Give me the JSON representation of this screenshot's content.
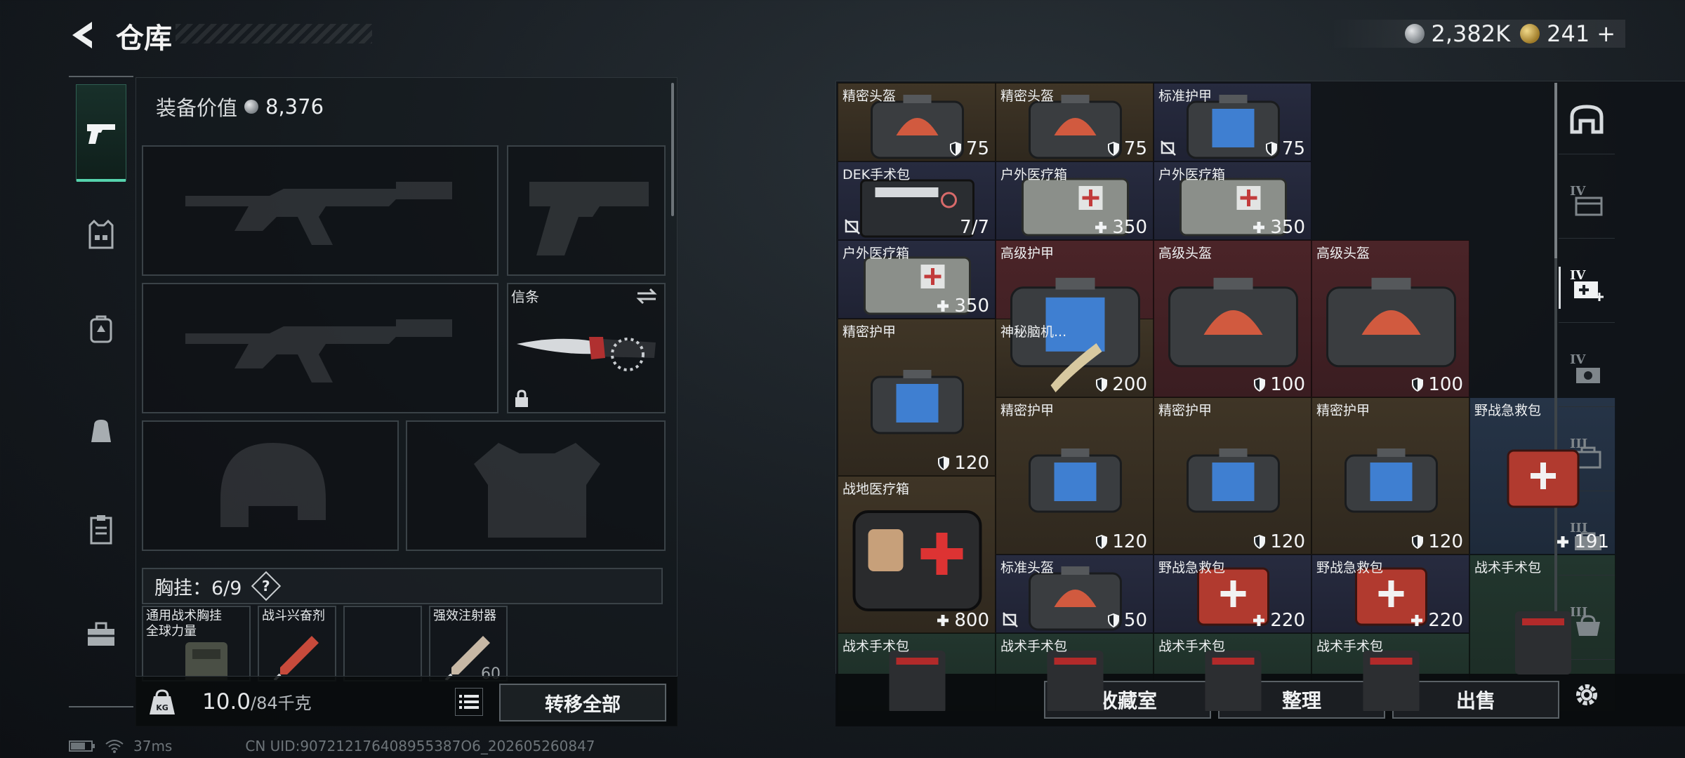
{
  "header": {
    "title": "仓库",
    "silver_amount": "2,382K",
    "gold_amount": "241",
    "gold_add": "+"
  },
  "equipment": {
    "value_label": "装备价值",
    "value": "8,376",
    "melee_label": "信条",
    "chest_label": "胸挂：",
    "chest_count": "6/9",
    "help": "?",
    "small_slots": [
      {
        "label": "通用战术胸挂\n全球力量",
        "amount": ""
      },
      {
        "label": "战斗兴奋剂",
        "amount": ""
      },
      {
        "label": "",
        "amount": ""
      },
      {
        "label": "强效注射器",
        "amount": "60"
      }
    ],
    "weight_value": "10.0",
    "weight_unit": "/84千克",
    "weight_icon_text": "KG",
    "transfer_all": "转移全部"
  },
  "status": {
    "ping": "37ms",
    "uid": "CN UID:907212176408955387O6_202605260847"
  },
  "storage": {
    "items": [
      {
        "name": "精密头盔",
        "value": "75",
        "kind": "shield",
        "bg": "brown",
        "art": "helmet"
      },
      {
        "name": "精密头盔",
        "value": "75",
        "kind": "shield",
        "bg": "brown",
        "art": "helmet"
      },
      {
        "name": "标准护甲",
        "value": "75",
        "kind": "shield",
        "bg": "navy",
        "art": "armor",
        "flag": true
      },
      {
        "name": "DEK手术包",
        "value": "7/7",
        "kind": "none",
        "bg": "navy",
        "art": "kit",
        "flag": true
      },
      {
        "name": "户外医疗箱",
        "value": "350",
        "kind": "plus",
        "bg": "navy",
        "art": "medbox"
      },
      {
        "name": "户外医疗箱",
        "value": "350",
        "kind": "plus",
        "bg": "navy",
        "art": "medbox"
      },
      {
        "name": "户外医疗箱",
        "value": "350",
        "kind": "plus",
        "bg": "navy",
        "art": "medbox"
      },
      {
        "name": "高级护甲",
        "value": "200",
        "kind": "shield",
        "bg": "red",
        "art": "armor-big"
      },
      {
        "name": "高级头盔",
        "value": "100",
        "kind": "shield",
        "bg": "red",
        "art": "helmet-big"
      },
      {
        "name": "高级头盔",
        "value": "100",
        "kind": "shield",
        "bg": "red",
        "art": "helmet-big"
      },
      {
        "name": "精密护甲",
        "value": "120",
        "kind": "shield",
        "bg": "brown",
        "art": "armor"
      },
      {
        "name": "神秘脑机...",
        "value": "",
        "kind": "none",
        "bg": "brown",
        "art": "scroll"
      },
      {
        "name": "精密护甲",
        "value": "120",
        "kind": "shield",
        "bg": "brown",
        "art": "armor"
      },
      {
        "name": "精密护甲",
        "value": "120",
        "kind": "shield",
        "bg": "brown",
        "art": "armor"
      },
      {
        "name": "精密护甲",
        "value": "120",
        "kind": "shield",
        "bg": "brown",
        "art": "armor"
      },
      {
        "name": "野战急救包",
        "value": "191",
        "kind": "plus",
        "bg": "blue",
        "art": "redpack-tall"
      },
      {
        "name": "战地医疗箱",
        "value": "800",
        "kind": "plus",
        "bg": "brown",
        "art": "firstaid"
      },
      {
        "name": "标准头盔",
        "value": "50",
        "kind": "shield",
        "bg": "navy",
        "art": "helmet",
        "flag": true
      },
      {
        "name": "野战急救包",
        "value": "220",
        "kind": "plus",
        "bg": "navy",
        "art": "redpack"
      },
      {
        "name": "野战急救包",
        "value": "220",
        "kind": "plus",
        "bg": "navy",
        "art": "redpack"
      },
      {
        "name": "战术手术包",
        "value": "",
        "kind": "none",
        "bg": "green",
        "art": "tactical-tall"
      },
      {
        "name": "战术手术包",
        "value": "",
        "kind": "none",
        "bg": "green",
        "art": "tactical"
      },
      {
        "name": "战术手术包",
        "value": "",
        "kind": "none",
        "bg": "green",
        "art": "tactical"
      },
      {
        "name": "战术手术包",
        "value": "",
        "kind": "none",
        "bg": "green",
        "art": "tactical"
      },
      {
        "name": "战术手术包",
        "value": "",
        "kind": "none",
        "bg": "green",
        "art": "tactical"
      }
    ],
    "collection_btn": "收藏室",
    "organize_btn": "整理",
    "sell_btn": "出售"
  },
  "right_nav": [
    {
      "icon": "vault-icon",
      "roman": ""
    },
    {
      "icon": "container-iv-icon",
      "roman": "IV"
    },
    {
      "icon": "medkit-iv-icon",
      "roman": "IV"
    },
    {
      "icon": "camera-iv-icon",
      "roman": "IV"
    },
    {
      "icon": "container-iii-icon",
      "roman": "III"
    },
    {
      "icon": "case-iii-icon",
      "roman": "III"
    },
    {
      "icon": "bag-iii-icon",
      "roman": "III"
    }
  ]
}
